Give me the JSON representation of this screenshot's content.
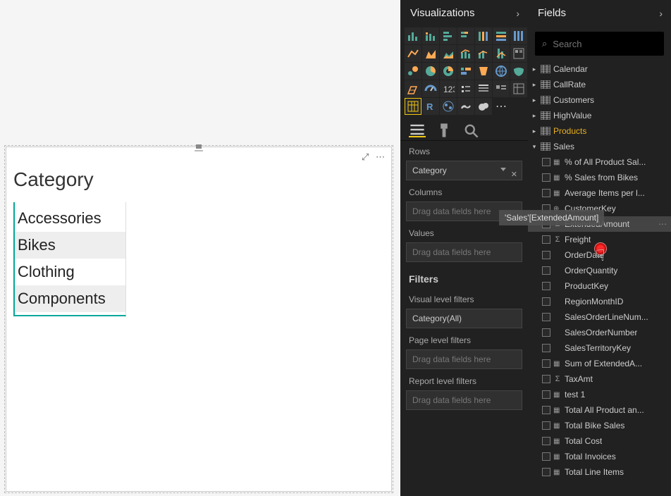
{
  "vis_panel": {
    "title": "Visualizations",
    "rows_label": "Rows",
    "rows_value": "Category",
    "columns_label": "Columns",
    "columns_placeholder": "Drag data fields here",
    "values_label": "Values",
    "values_placeholder": "Drag data fields here",
    "filters_title": "Filters",
    "visual_filters_label": "Visual level filters",
    "visual_filters_value": "Category(All)",
    "page_filters_label": "Page level filters",
    "page_filters_placeholder": "Drag data fields here",
    "report_filters_label": "Report level filters",
    "report_filters_placeholder": "Drag data fields here"
  },
  "fields_panel": {
    "title": "Fields",
    "search_placeholder": "Search",
    "tables": [
      "Calendar",
      "CallRate",
      "Customers",
      "HighValue",
      "Products",
      "Sales"
    ],
    "sales_fields": [
      {
        "name": "% of All Product Sal...",
        "type": "calc"
      },
      {
        "name": "% Sales from Bikes",
        "type": "calc"
      },
      {
        "name": "Average Items per l...",
        "type": "calc",
        "obscured": true
      },
      {
        "name": "CustomerKey",
        "type": "link"
      },
      {
        "name": "ExtendedAmount",
        "type": "sum",
        "highlight": true
      },
      {
        "name": "Freight",
        "type": "sum"
      },
      {
        "name": "OrderDate",
        "type": "plain"
      },
      {
        "name": "OrderQuantity",
        "type": "plain"
      },
      {
        "name": "ProductKey",
        "type": "plain"
      },
      {
        "name": "RegionMonthID",
        "type": "plain"
      },
      {
        "name": "SalesOrderLineNum...",
        "type": "plain"
      },
      {
        "name": "SalesOrderNumber",
        "type": "plain"
      },
      {
        "name": "SalesTerritoryKey",
        "type": "plain"
      },
      {
        "name": "Sum of ExtendedA...",
        "type": "calc"
      },
      {
        "name": "TaxAmt",
        "type": "sum"
      },
      {
        "name": "test 1",
        "type": "calc"
      },
      {
        "name": "Total All Product an...",
        "type": "calc"
      },
      {
        "name": "Total Bike Sales",
        "type": "calc"
      },
      {
        "name": "Total Cost",
        "type": "calc"
      },
      {
        "name": "Total Invoices",
        "type": "calc"
      },
      {
        "name": "Total Line Items",
        "type": "calc"
      }
    ]
  },
  "matrix": {
    "header": "Category",
    "rows": [
      "Accessories",
      "Bikes",
      "Clothing",
      "Components"
    ]
  },
  "tooltip": "'Sales'[ExtendedAmount]"
}
